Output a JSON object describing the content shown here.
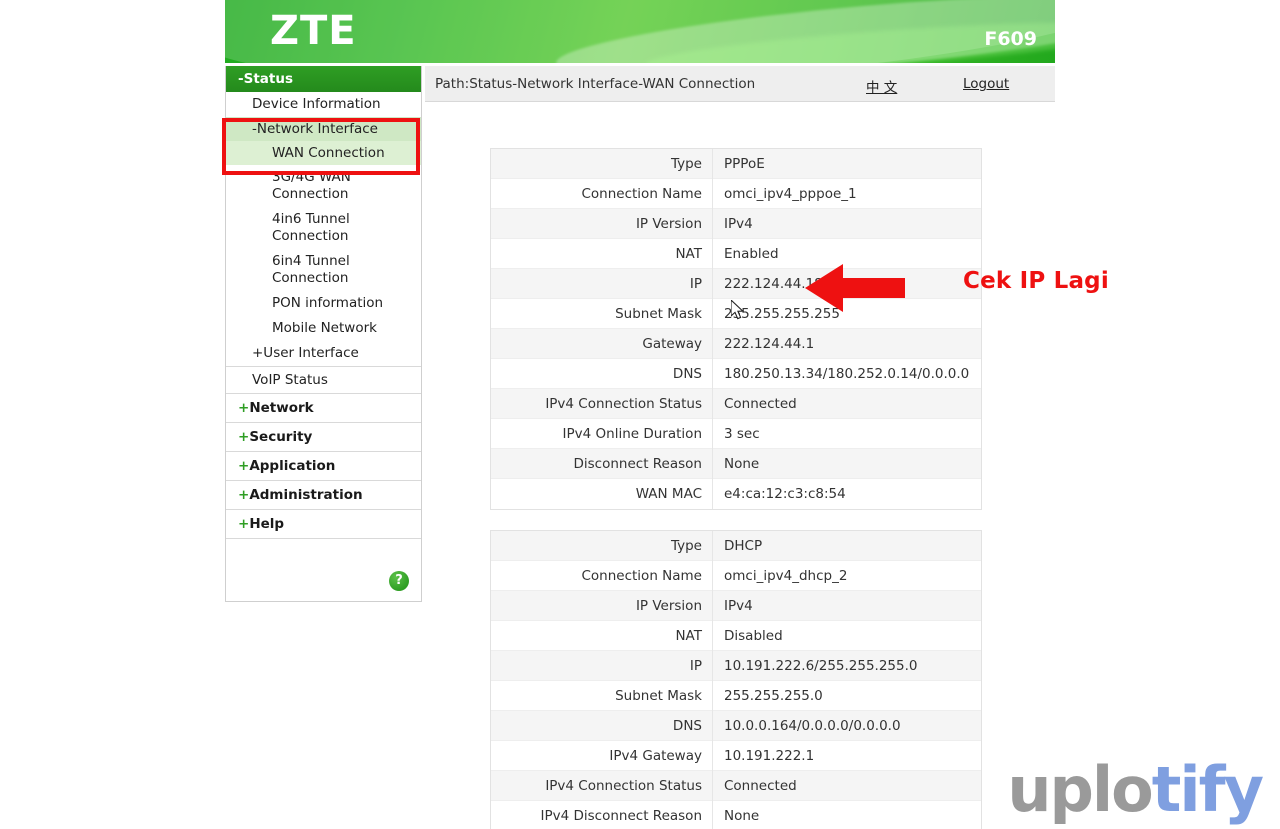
{
  "banner": {
    "brand": "ZTE",
    "model": "F609"
  },
  "pathbar": {
    "path": "Path:Status-Network Interface-WAN Connection",
    "language_link": "中 文",
    "logout_link": "Logout"
  },
  "sidebar": {
    "status_header": "-Status",
    "device_information": "Device Information",
    "network_interface": "-Network Interface",
    "wan_connection": "WAN Connection",
    "sub_items": [
      "3G/4G WAN Connection",
      "4in6 Tunnel Connection",
      "6in4 Tunnel Connection",
      "PON information",
      "Mobile Network"
    ],
    "user_interface": "+User Interface",
    "voip_status": "VoIP Status",
    "top_items": [
      {
        "plus": "+",
        "label": "Network"
      },
      {
        "plus": "+",
        "label": "Security"
      },
      {
        "plus": "+",
        "label": "Application"
      },
      {
        "plus": "+",
        "label": "Administration"
      },
      {
        "plus": "+",
        "label": "Help"
      }
    ],
    "help_icon_glyph": "?"
  },
  "tables": [
    {
      "id": "pppoe",
      "rows": [
        {
          "label": "Type",
          "value": "PPPoE"
        },
        {
          "label": "Connection Name",
          "value": "omci_ipv4_pppoe_1"
        },
        {
          "label": "IP Version",
          "value": "IPv4"
        },
        {
          "label": "NAT",
          "value": "Enabled"
        },
        {
          "label": "IP",
          "value": "222.124.44.187"
        },
        {
          "label": "Subnet Mask",
          "value": "255.255.255.255"
        },
        {
          "label": "Gateway",
          "value": "222.124.44.1"
        },
        {
          "label": "DNS",
          "value": "180.250.13.34/180.252.0.14/0.0.0.0"
        },
        {
          "label": "IPv4 Connection Status",
          "value": "Connected"
        },
        {
          "label": "IPv4 Online Duration",
          "value": "3 sec"
        },
        {
          "label": "Disconnect Reason",
          "value": "None"
        },
        {
          "label": "WAN MAC",
          "value": "e4:ca:12:c3:c8:54"
        }
      ]
    },
    {
      "id": "dhcp",
      "rows": [
        {
          "label": "Type",
          "value": "DHCP"
        },
        {
          "label": "Connection Name",
          "value": "omci_ipv4_dhcp_2"
        },
        {
          "label": "IP Version",
          "value": "IPv4"
        },
        {
          "label": "NAT",
          "value": "Disabled"
        },
        {
          "label": "IP",
          "value": "10.191.222.6/255.255.255.0"
        },
        {
          "label": "Subnet Mask",
          "value": "255.255.255.0"
        },
        {
          "label": "DNS",
          "value": "10.0.0.164/0.0.0.0/0.0.0.0"
        },
        {
          "label": "IPv4 Gateway",
          "value": "10.191.222.1"
        },
        {
          "label": "IPv4 Connection Status",
          "value": "Connected"
        },
        {
          "label": "IPv4 Disconnect Reason",
          "value": "None"
        }
      ]
    }
  ],
  "annotation": {
    "text": "Cek IP Lagi",
    "color": "#ee1111"
  },
  "watermark": {
    "part_a": "uplo",
    "part_b": "tify",
    "color_a": "#9a9a9a",
    "color_b": "#7f9fe0"
  }
}
